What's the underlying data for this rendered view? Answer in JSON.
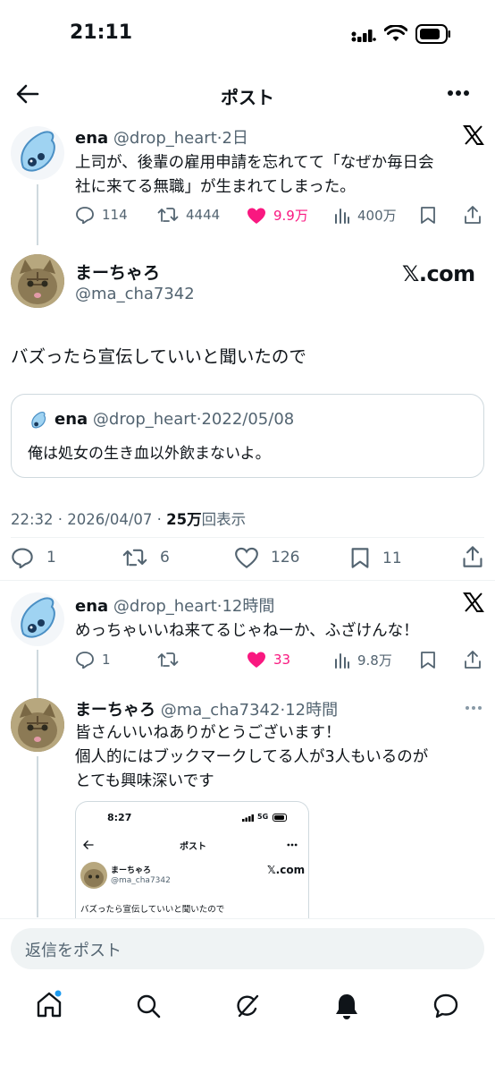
{
  "status_bar": {
    "time": "21:11"
  },
  "header": {
    "title": "ポスト"
  },
  "reply_context": {
    "name": "ena",
    "handle": "@drop_heart",
    "sep": "·",
    "time": "2日",
    "text_line1": "上司が、後輩の雇用申請を忘れてて「なぜか毎日会",
    "text_line2": "社に来てる無職」が生まれてしまった。",
    "replies": "114",
    "reposts": "4444",
    "likes": "9.9万",
    "views": "400万"
  },
  "main_post": {
    "name": "まーちゃろ",
    "handle": "@ma_cha7342",
    "brand": "𝕏.com",
    "text": "バズったら宣伝していいと聞いたので",
    "quote": {
      "name": "ena",
      "handle": "@drop_heart",
      "sep": "·",
      "date": "2022/05/08",
      "text": "俺は処女の生き血以外飲まないよ。"
    },
    "meta_time": "22:32 · 2026/04/07 · ",
    "meta_views": "25万",
    "meta_views_suffix": "回表示",
    "replies": "1",
    "reposts": "6",
    "likes": "126",
    "bookmarks": "11"
  },
  "reply1": {
    "name": "ena",
    "handle": "@drop_heart",
    "sep": "·",
    "time": "12時間",
    "text": "めっちゃいいね来てるじゃねーか、ふざけんな！",
    "replies": "1",
    "likes": "33",
    "views": "9.8万"
  },
  "reply2": {
    "name": "まーちゃろ",
    "handle": "@ma_cha7342",
    "sep": "·",
    "time": "12時間",
    "text_line1": "皆さんいいねありがとうございます！",
    "text_line2": "個人的にはブックマークしてる人が3人もいるのが",
    "text_line3": "とても興味深いです",
    "embedded": {
      "time": "8:27",
      "network": "5G",
      "title": "ポスト",
      "name": "まーちゃろ",
      "handle": "@ma_cha7342",
      "brand": "𝕏.com",
      "text": "バズったら宣伝していいと聞いたので"
    }
  },
  "reply_bar": {
    "placeholder": "返信をポスト"
  },
  "colors": {
    "like": "#f91880",
    "accent": "#1d9bf0",
    "muted": "#536471"
  }
}
